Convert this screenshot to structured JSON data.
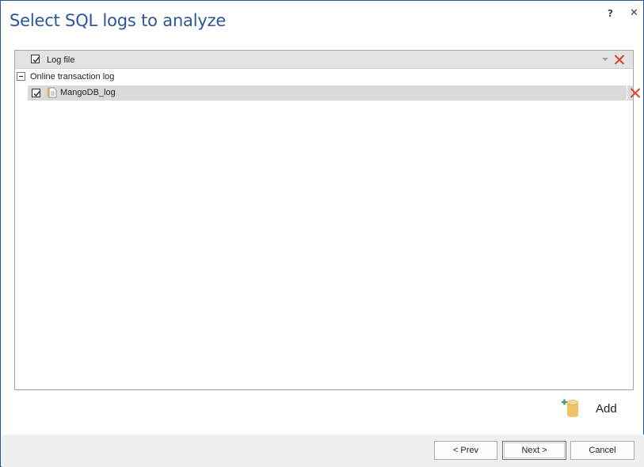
{
  "dialog": {
    "title": "Select SQL logs to analyze",
    "help_label": "?",
    "close_label": "✕"
  },
  "grid": {
    "column_header": "Log file",
    "header_checked": true,
    "groups": [
      {
        "label": "Online transaction log",
        "expanded": true,
        "rows": [
          {
            "checked": true,
            "name": "MangoDB_log",
            "icon": "file-icon"
          }
        ]
      }
    ]
  },
  "actions": {
    "add_label": "Add"
  },
  "footer": {
    "prev_label": "< Prev",
    "next_label": "Next >",
    "cancel_label": "Cancel"
  },
  "colors": {
    "title": "#2b579a",
    "delete_icon": "#d9452b",
    "header_bg": "#e3e3e3",
    "selected_row_bg": "#dadada",
    "add_icon_cylinder": "#f0c36b",
    "add_icon_plus": "#4a9c7a"
  }
}
